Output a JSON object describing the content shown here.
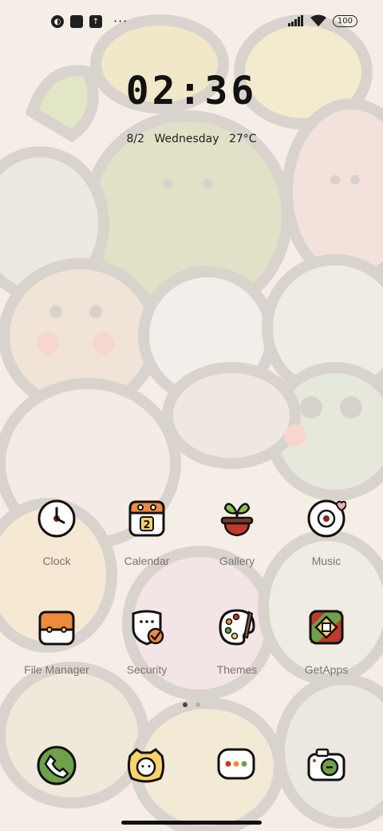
{
  "status_bar": {
    "left_icons": [
      "app-notification-icon",
      "square-icon",
      "upload-icon"
    ],
    "more": "···",
    "battery": "100",
    "right_icons": [
      "signal-icon",
      "wifi-icon",
      "battery-icon"
    ]
  },
  "lock": {
    "time": "02:36",
    "date": "8/2",
    "weekday": "Wednesday",
    "temperature": "27°C"
  },
  "apps": [
    {
      "label": "Clock",
      "icon": "clock-icon"
    },
    {
      "label": "Calendar",
      "icon": "calendar-icon",
      "badge": "2"
    },
    {
      "label": "Gallery",
      "icon": "plant-pot-icon"
    },
    {
      "label": "Music",
      "icon": "music-record-icon"
    },
    {
      "label": "File Manager",
      "icon": "folder-icon"
    },
    {
      "label": "Security",
      "icon": "shield-check-icon"
    },
    {
      "label": "Themes",
      "icon": "palette-icon"
    },
    {
      "label": "GetApps",
      "icon": "getapps-icon"
    }
  ],
  "page_indicator": {
    "pages": 2,
    "active": 1
  },
  "dock": [
    {
      "icon": "phone-icon"
    },
    {
      "icon": "messages-character-icon"
    },
    {
      "icon": "chat-bubble-icon"
    },
    {
      "icon": "camera-icon"
    }
  ],
  "colors": {
    "background": "#f4ede4",
    "orange": "#f08a3c",
    "green": "#6fa04a",
    "red": "#c0392b",
    "yellow": "#f6d36b"
  }
}
